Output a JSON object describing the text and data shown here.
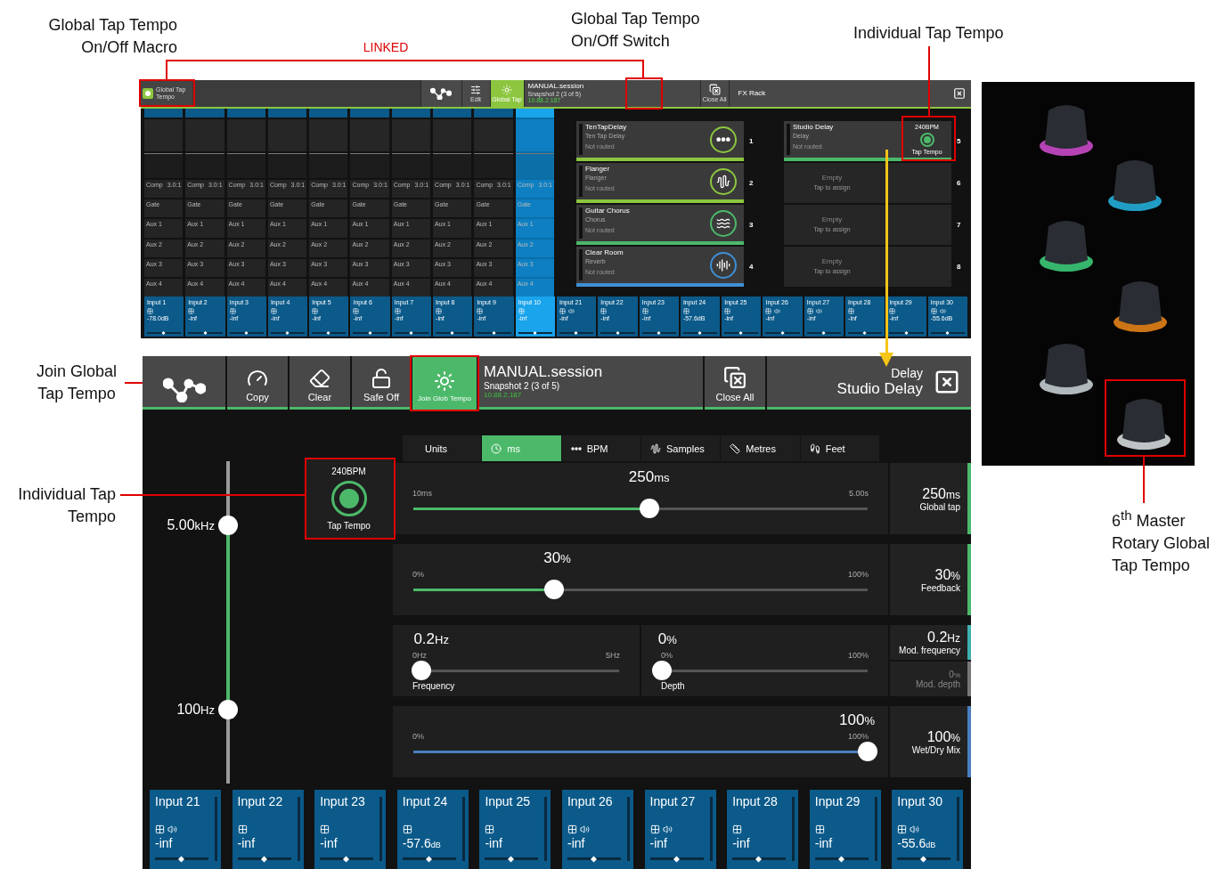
{
  "annotations": [
    {
      "kind": "callout",
      "lines": [
        "Global Tap Tempo",
        "On/Off Macro"
      ]
    },
    {
      "kind": "link",
      "lines": [
        "LINKED"
      ]
    },
    {
      "kind": "callout",
      "lines": [
        "Global Tap Tempo",
        "On/Off Switch"
      ]
    },
    {
      "kind": "callout",
      "lines": [
        "Individual Tap Tempo"
      ]
    },
    {
      "kind": "callout",
      "lines": [
        "Join Global",
        "Tap Tempo"
      ]
    },
    {
      "kind": "callout",
      "lines": [
        "Individual Tap",
        "Tempo"
      ]
    },
    {
      "kind": "callout",
      "lines": [
        "6$^{th}$ Master",
        "Rotary Global",
        "Tap Tempo"
      ]
    }
  ],
  "overview": {
    "macro": {
      "label": "Global Tap Tempo",
      "on": true
    },
    "toolbar": {
      "edit": "Edit",
      "global_tap": {
        "label": "Global Tap",
        "on": true
      },
      "session": "MANUAL.session",
      "snapshot": "Snapshot 2 (3 of 5)",
      "ip": "10.88.2.187",
      "close_all": "Close All",
      "rack": "FX Rack"
    },
    "strips": [
      {
        "name": "Input 1",
        "value": "-78.0",
        "unit": "dB",
        "selected": false,
        "ratio": "3.0:1",
        "sections": [
          "Comp",
          "Gate",
          "Aux 1",
          "Aux 2",
          "Aux 3",
          "Aux 4"
        ]
      },
      {
        "name": "Input 2",
        "value": "-inf",
        "selected": false,
        "ratio": "3.0:1",
        "sections": [
          "Comp",
          "Gate",
          "Aux 1",
          "Aux 2",
          "Aux 3",
          "Aux 4"
        ]
      },
      {
        "name": "Input 3",
        "value": "-inf",
        "selected": false,
        "ratio": "3.0:1",
        "sections": [
          "Comp",
          "Gate",
          "Aux 1",
          "Aux 2",
          "Aux 3",
          "Aux 4"
        ]
      },
      {
        "name": "Input 4",
        "value": "-inf",
        "selected": false,
        "ratio": "3.0:1",
        "sections": [
          "Comp",
          "Gate",
          "Aux 1",
          "Aux 2",
          "Aux 3",
          "Aux 4"
        ]
      },
      {
        "name": "Input 5",
        "value": "-inf",
        "selected": false,
        "ratio": "3.0:1",
        "sections": [
          "Comp",
          "Gate",
          "Aux 1",
          "Aux 2",
          "Aux 3",
          "Aux 4"
        ]
      },
      {
        "name": "Input 6",
        "value": "-inf",
        "selected": false,
        "ratio": "3.0:1",
        "sections": [
          "Comp",
          "Gate",
          "Aux 1",
          "Aux 2",
          "Aux 3",
          "Aux 4"
        ]
      },
      {
        "name": "Input 7",
        "value": "-inf",
        "selected": false,
        "ratio": "3.0:1",
        "sections": [
          "Comp",
          "Gate",
          "Aux 1",
          "Aux 2",
          "Aux 3",
          "Aux 4"
        ]
      },
      {
        "name": "Input 8",
        "value": "-inf",
        "selected": false,
        "ratio": "3.0:1",
        "sections": [
          "Comp",
          "Gate",
          "Aux 1",
          "Aux 2",
          "Aux 3",
          "Aux 4"
        ]
      },
      {
        "name": "Input 9",
        "value": "-inf",
        "selected": false,
        "ratio": "3.0:1",
        "sections": [
          "Comp",
          "Gate",
          "Aux 1",
          "Aux 2",
          "Aux 3",
          "Aux 4"
        ]
      },
      {
        "name": "Input 10",
        "value": "-inf",
        "selected": true,
        "ratio": "3.0:1",
        "sections": [
          "Comp",
          "Gate",
          "Aux 1",
          "Aux 2",
          "Aux 3",
          "Aux 4"
        ]
      }
    ],
    "fx_slots": [
      {
        "kind": "multitap",
        "number": "1",
        "name": "TenTapDelay",
        "type": "Ten Tap Delay",
        "status": "Not routed",
        "color": "#8cc63f"
      },
      {
        "kind": "modulation",
        "number": "2",
        "name": "Flanger",
        "type": "Flanger",
        "status": "Not routed",
        "color": "#8cc63f"
      },
      {
        "kind": "chorus",
        "number": "3",
        "name": "Guitar Chorus",
        "type": "Chorus",
        "status": "Not routed",
        "color": "#4cb96a"
      },
      {
        "kind": "reverb",
        "number": "4",
        "name": "Clear Room",
        "type": "Reverb",
        "status": "Not routed",
        "color": "#3f8fd6"
      },
      {
        "kind": "tap",
        "number": "5",
        "name": "Studio Delay",
        "type": "Delay",
        "status": "Not routed",
        "color": "#4cb96a",
        "tap": {
          "bpm": "240BPM",
          "label": "Tap Tempo",
          "on": true
        }
      },
      {
        "kind": "empty",
        "number": "6",
        "name": "Empty",
        "status": "Tap to assign"
      },
      {
        "kind": "empty",
        "number": "7",
        "name": "Empty",
        "status": "Tap to assign"
      },
      {
        "kind": "empty",
        "number": "8",
        "name": "Empty",
        "status": "Tap to assign"
      }
    ],
    "inputs": [
      {
        "name": "Input 21",
        "value": "-inf",
        "send": true
      },
      {
        "name": "Input 22",
        "value": "-inf",
        "send": false
      },
      {
        "name": "Input 23",
        "value": "-inf",
        "send": false
      },
      {
        "name": "Input 24",
        "value": "-57.6",
        "unit": "dB",
        "send": false
      },
      {
        "name": "Input 25",
        "value": "-inf",
        "send": false
      },
      {
        "name": "Input 26",
        "value": "-inf",
        "send": true
      },
      {
        "name": "Input 27",
        "value": "-inf",
        "send": true
      },
      {
        "name": "Input 28",
        "value": "-inf",
        "send": false
      },
      {
        "name": "Input 29",
        "value": "-inf",
        "send": false
      },
      {
        "name": "Input 30",
        "value": "-55.6",
        "unit": "dB",
        "send": true
      }
    ]
  },
  "detail": {
    "toolbar": [
      {
        "kind": "routing"
      },
      {
        "kind": "copy",
        "label": "Copy"
      },
      {
        "kind": "clear",
        "label": "Clear"
      },
      {
        "kind": "safe",
        "label": "Safe Off"
      },
      {
        "kind": "tempo",
        "label": "Join Glob Tempo",
        "on": true
      }
    ],
    "session": {
      "name": "MANUAL.session",
      "snapshot": "Snapshot 2 (3 of 5)",
      "ip": "10.88.2.187"
    },
    "close_all": "Close All",
    "effect": {
      "type": "Delay",
      "name": "Studio Delay"
    },
    "filter": {
      "high": {
        "value": "5.00",
        "unit": "kHz",
        "level": 0.8
      },
      "low": {
        "value": "100",
        "unit": "Hz",
        "level": 0.23
      }
    },
    "tap": {
      "bpm": "240BPM",
      "label": "Tap Tempo",
      "on": true
    },
    "units_label": "Units",
    "units": [
      {
        "kind": "time",
        "label": "ms",
        "selected": true
      },
      {
        "kind": "tempo",
        "label": "BPM",
        "selected": false
      },
      {
        "kind": "samples",
        "label": "Samples",
        "selected": false
      },
      {
        "kind": "metres",
        "label": "Metres",
        "selected": false
      },
      {
        "kind": "feet",
        "label": "Feet",
        "selected": false
      }
    ],
    "params": [
      {
        "sliders": [
          {
            "value": "250",
            "unit": "ms",
            "min": "10ms",
            "max": "5.00s",
            "level": 0.52
          }
        ],
        "readouts": [
          {
            "value": "250",
            "unit": "ms",
            "label": "Global tap",
            "color": "#4cb96a",
            "disabled": false
          }
        ]
      },
      {
        "sliders": [
          {
            "value": "30",
            "unit": "%",
            "min": "0%",
            "max": "100%",
            "level": 0.31
          }
        ],
        "readouts": [
          {
            "value": "30",
            "unit": "%",
            "label": "Feedback",
            "color": "#4cb96a",
            "disabled": false
          }
        ]
      },
      {
        "sliders": [
          {
            "value": "0.2",
            "unit": "Hz",
            "min": "0Hz",
            "max": "5Hz",
            "level": 0.04,
            "label": "Frequency"
          },
          {
            "value": "0",
            "unit": "%",
            "min": "0%",
            "max": "100%",
            "level": 0,
            "label": "Depth"
          }
        ],
        "readouts": [
          {
            "value": "0.2",
            "unit": "Hz",
            "label": "Mod. frequency",
            "color": "#3fb0b0",
            "disabled": false
          },
          {
            "value": "0",
            "unit": "%",
            "label": "Mod. depth",
            "color": "#777777",
            "disabled": true
          }
        ]
      },
      {
        "sliders": [
          {
            "value": "100",
            "unit": "%",
            "min": "0%",
            "max": "100%",
            "level": 1
          }
        ],
        "readouts": [
          {
            "value": "100",
            "unit": "%",
            "label": "Wet/Dry Mix",
            "color": "#4a7fc0",
            "disabled": false
          }
        ]
      }
    ],
    "inputs": [
      {
        "name": "Input 21",
        "value": "-inf",
        "send": true
      },
      {
        "name": "Input 22",
        "value": "-inf",
        "send": false
      },
      {
        "name": "Input 23",
        "value": "-inf",
        "send": false
      },
      {
        "name": "Input 24",
        "value": "-57.6",
        "unit": "dB",
        "send": false
      },
      {
        "name": "Input 25",
        "value": "-inf",
        "send": false
      },
      {
        "name": "Input 26",
        "value": "-inf",
        "send": true
      },
      {
        "name": "Input 27",
        "value": "-inf",
        "send": true
      },
      {
        "name": "Input 28",
        "value": "-inf",
        "send": false
      },
      {
        "name": "Input 29",
        "value": "-inf",
        "send": false
      },
      {
        "name": "Input 30",
        "value": "-55.6",
        "unit": "dB",
        "send": true
      }
    ]
  }
}
